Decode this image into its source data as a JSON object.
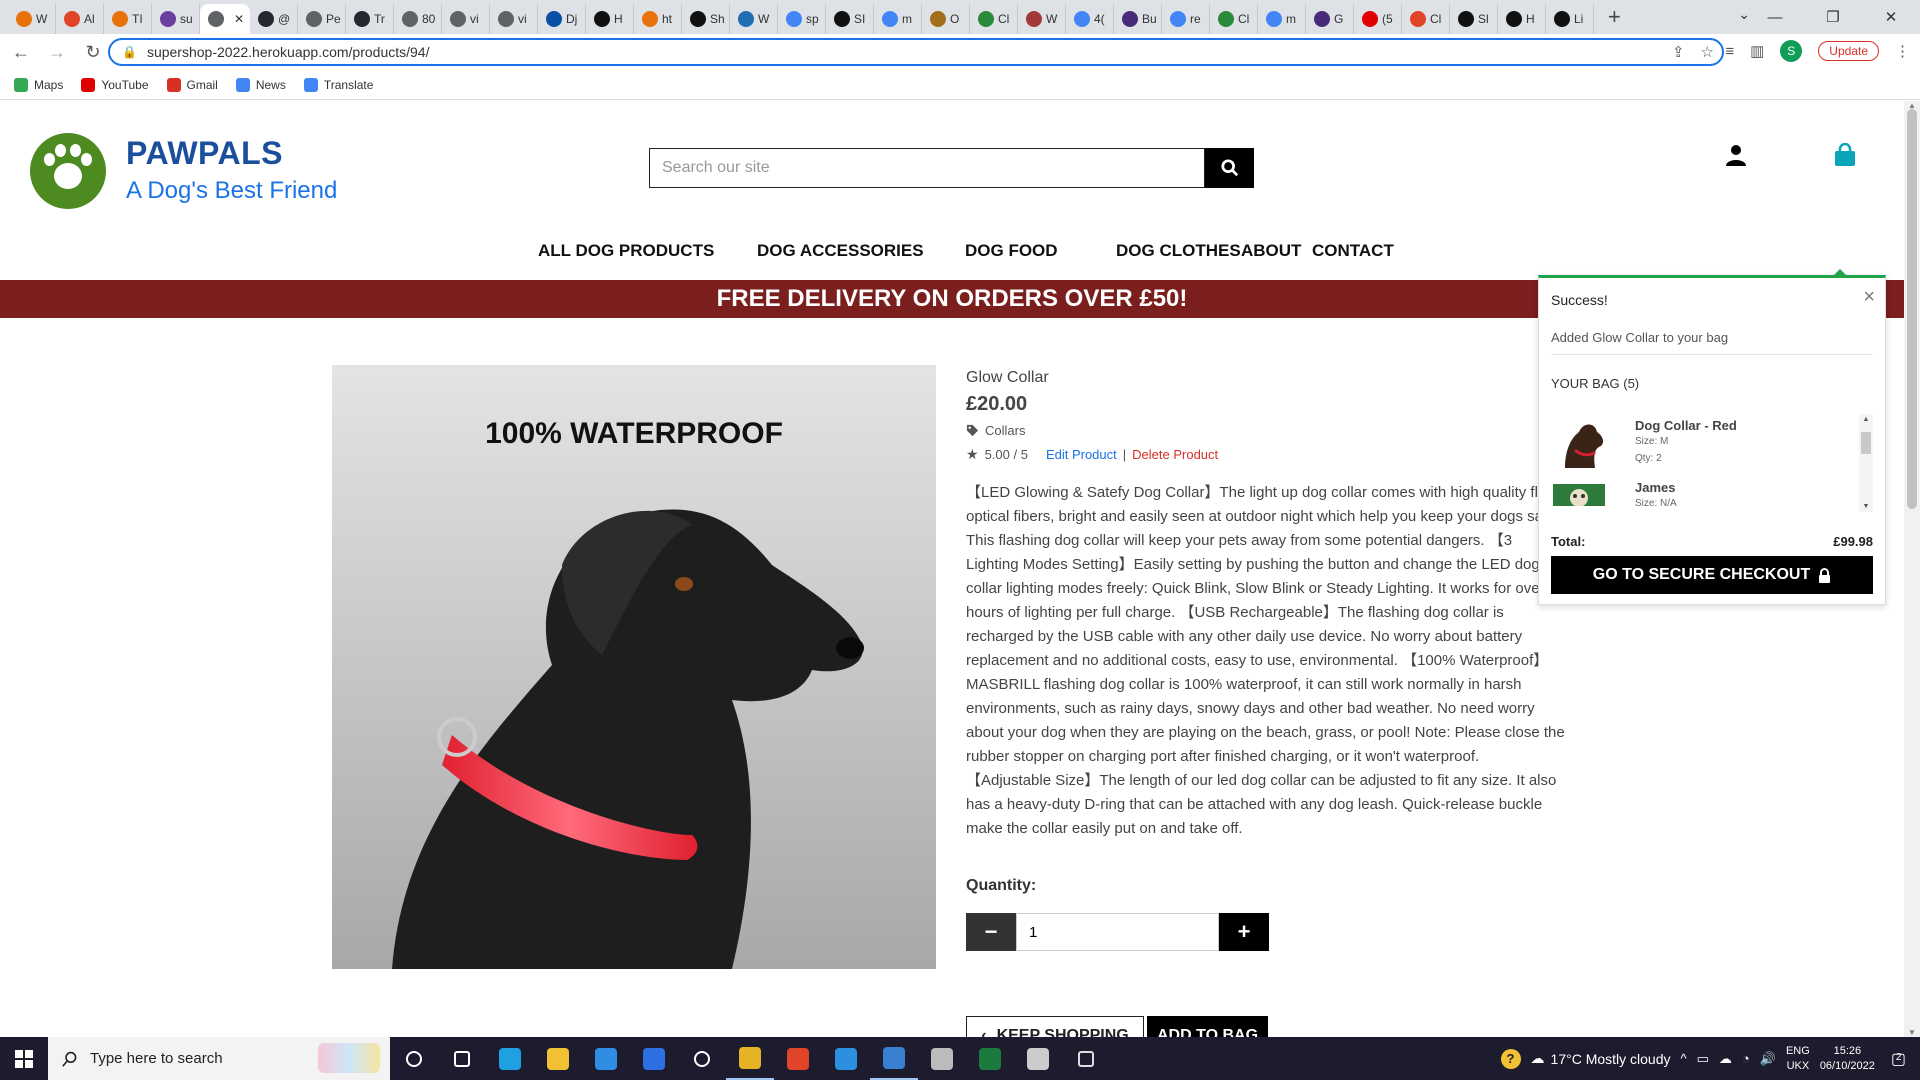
{
  "browser": {
    "tabs": [
      {
        "label": "W",
        "color": "#e8710a"
      },
      {
        "label": "Al",
        "color": "#e0452a"
      },
      {
        "label": "TI",
        "color": "#e8710a"
      },
      {
        "label": "su",
        "color": "#6b3fa0"
      },
      {
        "label": "",
        "color": "#5f6368",
        "active": true
      },
      {
        "label": "@",
        "color": "#24292f"
      },
      {
        "label": "Pe",
        "color": "#5f6368"
      },
      {
        "label": "Tr",
        "color": "#24292f"
      },
      {
        "label": "80",
        "color": "#5f6368"
      },
      {
        "label": "vi",
        "color": "#5f6368"
      },
      {
        "label": "vi",
        "color": "#5f6368"
      },
      {
        "label": "Dj",
        "color": "#0a4fa3"
      },
      {
        "label": "H",
        "color": "#111111"
      },
      {
        "label": "ht",
        "color": "#e8710a"
      },
      {
        "label": "Sh",
        "color": "#111111"
      },
      {
        "label": "W",
        "color": "#1f6fb2"
      },
      {
        "label": "sp",
        "color": "#4285f4"
      },
      {
        "label": "SI",
        "color": "#111111"
      },
      {
        "label": "m",
        "color": "#4285f4"
      },
      {
        "label": "O",
        "color": "#a36d1a"
      },
      {
        "label": "Cl",
        "color": "#2a8a3a"
      },
      {
        "label": "W",
        "color": "#a33a3a"
      },
      {
        "label": "4(",
        "color": "#4285f4"
      },
      {
        "label": "Bu",
        "color": "#4a2a7a"
      },
      {
        "label": "re",
        "color": "#4285f4"
      },
      {
        "label": "Cl",
        "color": "#2a8a3a"
      },
      {
        "label": "m",
        "color": "#4285f4"
      },
      {
        "label": "G",
        "color": "#4a2a7a"
      },
      {
        "label": "(5",
        "color": "#e00000"
      },
      {
        "label": "Cl",
        "color": "#e0452a"
      },
      {
        "label": "Sl",
        "color": "#111111"
      },
      {
        "label": "H",
        "color": "#111111"
      },
      {
        "label": "Li",
        "color": "#111111"
      }
    ],
    "url": "supershop-2022.herokuapp.com/products/94/",
    "update_label": "Update",
    "profile_initial": "S",
    "bookmarks": [
      {
        "label": "Maps",
        "color": "#34a853"
      },
      {
        "label": "YouTube",
        "color": "#e00000"
      },
      {
        "label": "Gmail",
        "color": "#d93025"
      },
      {
        "label": "News",
        "color": "#4285f4"
      },
      {
        "label": "Translate",
        "color": "#4285f4"
      }
    ]
  },
  "site": {
    "brand": "PAWPALS",
    "tagline": "A Dog's Best Friend",
    "search_placeholder": "Search our site",
    "nav": [
      "ALL DOG PRODUCTS",
      "DOG ACCESSORIES",
      "DOG FOOD",
      "DOG CLOTHES",
      "ABOUT",
      "CONTACT"
    ],
    "banner": "FREE DELIVERY ON ORDERS OVER £50!"
  },
  "product": {
    "image_caption": "100% WATERPROOF",
    "title": "Glow Collar",
    "price": "£20.00",
    "category": "Collars",
    "rating": "5.00 / 5",
    "edit_label": "Edit Product",
    "separator": "|",
    "delete_label": "Delete Product",
    "description": "【LED Glowing & Satefy Dog Collar】The light up dog collar comes with high quality flat optical fibers, bright and easily seen at outdoor night which help you keep your dogs safe. This flashing dog collar will keep your pets away from some potential dangers. 【3 Lighting Modes Setting】Easily setting by pushing the button and change the LED dog collar lighting modes freely: Quick Blink, Slow Blink or Steady Lighting. It works for over 8 hours of lighting per full charge. 【USB Rechargeable】The flashing dog collar is recharged by the USB cable with any other daily use device. No worry about battery replacement and no additional costs, easy to use, environmental. 【100% Waterproof】MASBRILL flashing dog collar is 100% waterproof, it can still work normally in harsh environments, such as rainy days, snowy days and other bad weather. No need worry about your dog when they are playing on the beach, grass, or pool! Note: Please close the rubber stopper on charging port after finished charging, or it won't waterproof. 【Adjustable Size】The length of our led dog collar can be adjusted to fit any size. It also has a heavy-duty D-ring that can be attached with any dog leash. Quick-release buckle make the collar easily put on and take off.",
    "quantity_label": "Quantity:",
    "quantity_value": "1",
    "keep_shopping_label": "KEEP SHOPPING",
    "add_to_bag_label": "ADD TO BAG"
  },
  "toast": {
    "title": "Success!",
    "message": "Added Glow Collar to your bag",
    "bag_heading": "YOUR BAG (5)",
    "items": [
      {
        "name": "Dog Collar - Red",
        "size": "Size: M",
        "qty": "Qty: 2"
      },
      {
        "name": "James",
        "size": "Size: N/A",
        "qty": ""
      }
    ],
    "total_label": "Total:",
    "total_value": "£99.98",
    "checkout_label": "GO TO SECURE CHECKOUT"
  },
  "taskbar": {
    "search_placeholder": "Type here to search",
    "apps": [
      {
        "name": "task-view",
        "color": "#ffffff"
      },
      {
        "name": "task-switch",
        "color": "#ffffff"
      },
      {
        "name": "edge",
        "color": "#1fa0e0"
      },
      {
        "name": "file-explorer",
        "color": "#f2c033"
      },
      {
        "name": "mail",
        "color": "#2f8de4"
      },
      {
        "name": "dropbox",
        "color": "#2f6fe4"
      },
      {
        "name": "github-desktop",
        "color": "#ffffff"
      },
      {
        "name": "chrome",
        "color": "#e6b325",
        "running": true
      },
      {
        "name": "office",
        "color": "#e0452a"
      },
      {
        "name": "vscode",
        "color": "#2c8fe0"
      },
      {
        "name": "photos",
        "color": "#3a7fd0",
        "running": true
      },
      {
        "name": "movie-maker",
        "color": "#bbbbbb"
      },
      {
        "name": "excel",
        "color": "#1d7a3e"
      },
      {
        "name": "paint",
        "color": "#cccccc"
      },
      {
        "name": "settings",
        "color": "#dddddd"
      }
    ],
    "weather": "17°C  Mostly cloudy",
    "lang_1": "ENG",
    "lang_2": "UKX",
    "time": "15:26",
    "date": "06/10/2022",
    "notifications": "2"
  }
}
